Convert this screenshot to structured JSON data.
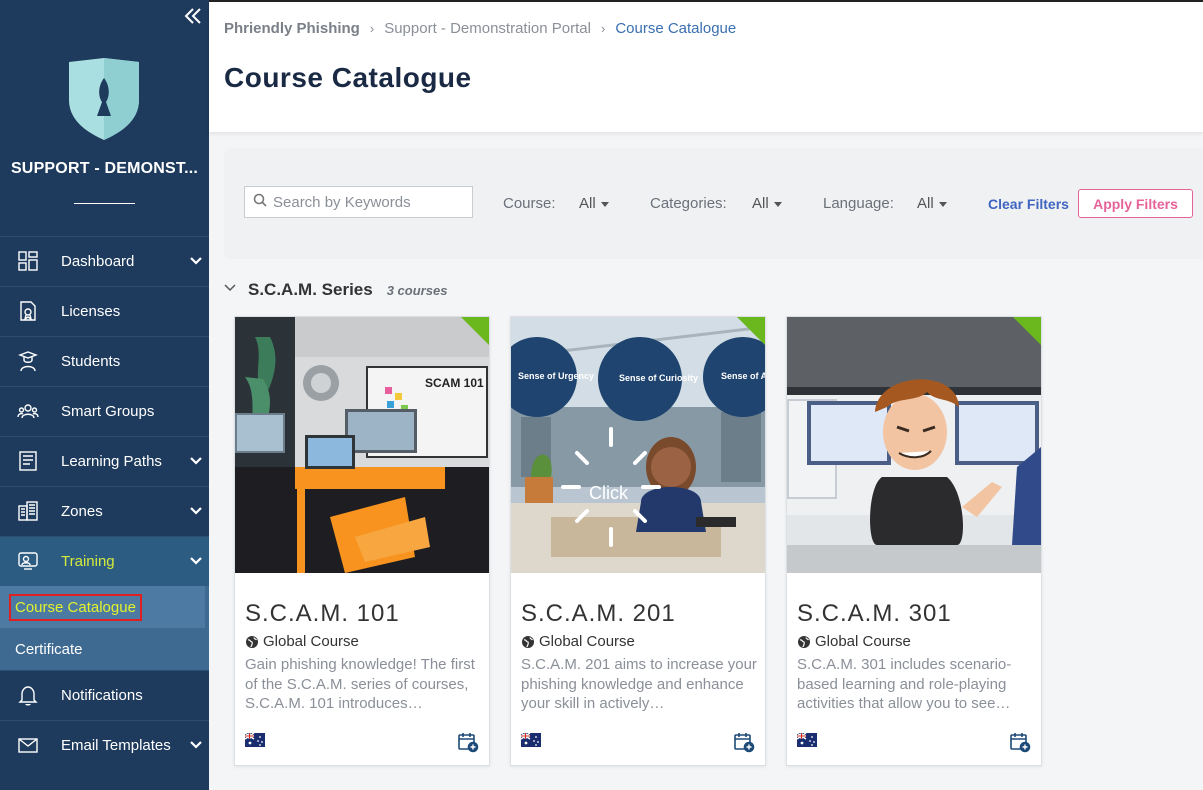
{
  "sidebar": {
    "org_name": "SUPPORT - DEMONST...",
    "items": [
      {
        "label": "Dashboard",
        "icon": "dashboard-icon"
      },
      {
        "label": "Licenses",
        "icon": "license-icon"
      },
      {
        "label": "Students",
        "icon": "student-icon"
      },
      {
        "label": "Smart Groups",
        "icon": "groups-icon"
      },
      {
        "label": "Learning Paths",
        "icon": "learning-path-icon"
      },
      {
        "label": "Zones",
        "icon": "buildings-icon"
      },
      {
        "label": "Training",
        "icon": "training-icon"
      },
      {
        "label": "Notifications",
        "icon": "bell-icon"
      },
      {
        "label": "Email Templates",
        "icon": "envelope-icon"
      }
    ],
    "training_sub": [
      {
        "label": "Course Catalogue"
      },
      {
        "label": "Certificate"
      }
    ]
  },
  "breadcrumb": {
    "items": [
      "Phriendly Phishing",
      "Support - Demonstration Portal",
      "Course Catalogue"
    ]
  },
  "page_title": "Course Catalogue",
  "filters": {
    "search_placeholder": "Search by Keywords",
    "course_label": "Course:",
    "course_value": "All",
    "categories_label": "Categories:",
    "categories_value": "All",
    "language_label": "Language:",
    "language_value": "All",
    "clear_label": "Clear Filters",
    "apply_label": "Apply Filters"
  },
  "series": {
    "title": "S.C.A.M. Series",
    "count": "3 courses"
  },
  "courses": [
    {
      "title": "S.C.A.M. 101",
      "type": "Global Course",
      "description": "Gain phishing knowledge! The first of the S.C.A.M. series of courses, S.C.A.M. 101 introduces…",
      "board_text": "SCAM 101"
    },
    {
      "title": "S.C.A.M. 201",
      "type": "Global Course",
      "description": "S.C.A.M. 201 aims to increase your phishing knowledge and enhance your skill in actively…",
      "circle1": "Sense of Urgency",
      "circle2": "Sense of Curiosity",
      "circle3": "Sense of Authority",
      "click_text": "Click"
    },
    {
      "title": "S.C.A.M. 301",
      "type": "Global Course",
      "description": "S.C.A.M. 301 includes scenario-based learning and role-playing activities that allow you to see…"
    }
  ],
  "colors": {
    "sidebar_bg": "#1e3a5c",
    "active_text": "#d4ea3a",
    "accent_blue": "#4065c0",
    "apply_pink": "#e6639a",
    "corner_green": "#6bb81e"
  }
}
